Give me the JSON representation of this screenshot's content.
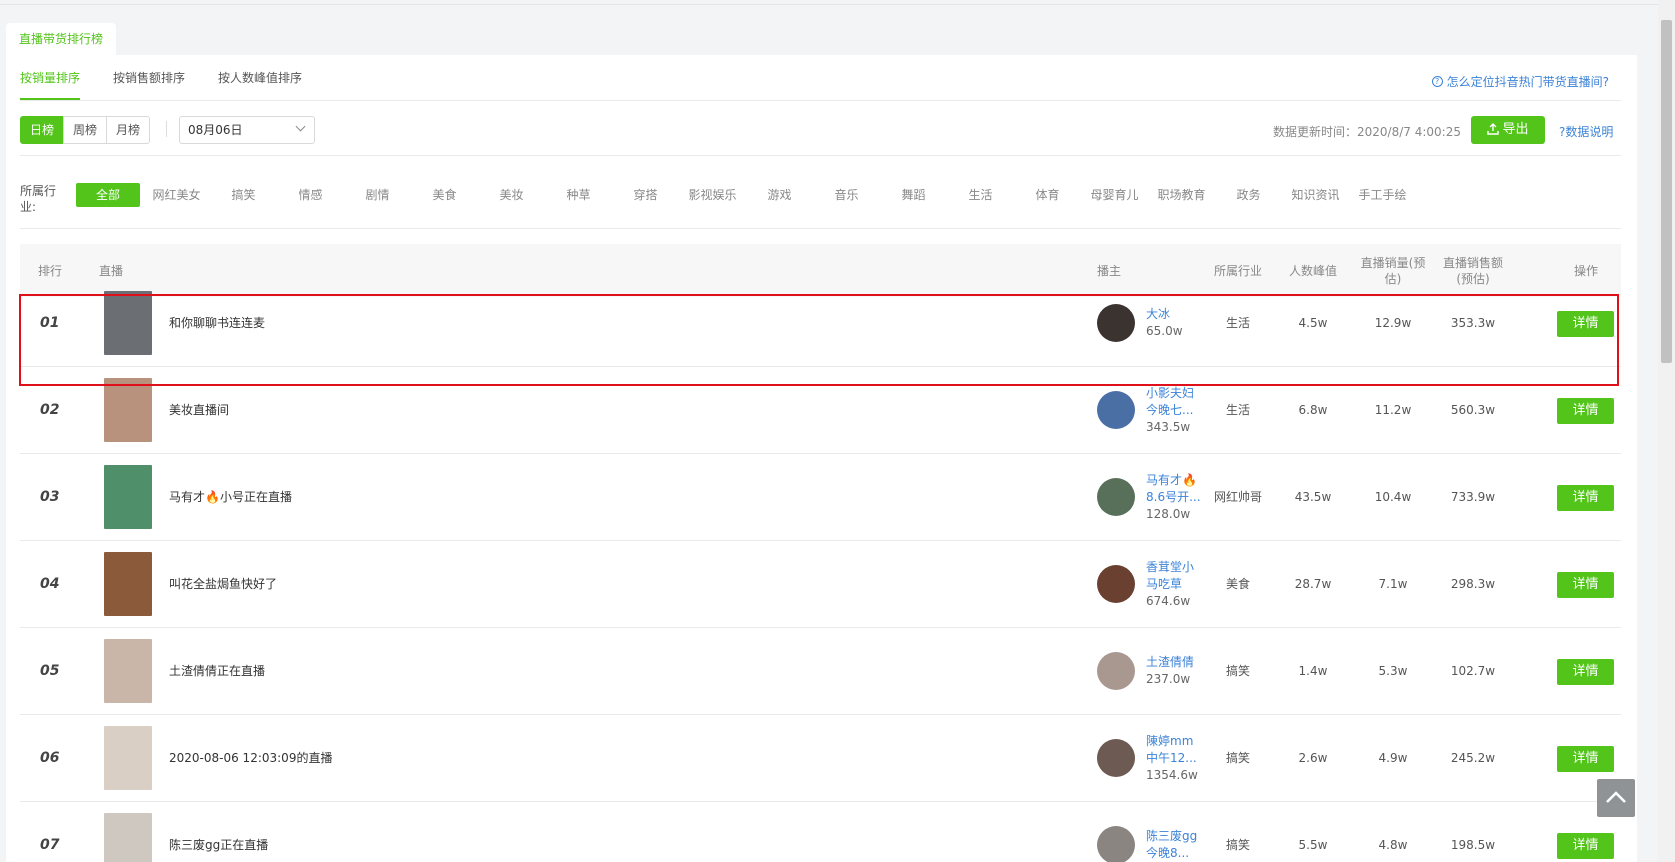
{
  "page_tab": "直播带货排行榜",
  "sort_tabs": [
    {
      "label": "按销量排序",
      "active": true
    },
    {
      "label": "按销售额排序",
      "active": false
    },
    {
      "label": "按人数峰值排序",
      "active": false
    }
  ],
  "help_link": "怎么定位抖音热门带货直播间?",
  "period_buttons": [
    {
      "label": "日榜",
      "active": true
    },
    {
      "label": "周榜",
      "active": false
    },
    {
      "label": "月榜",
      "active": false
    }
  ],
  "date_select": {
    "value": "08月06日"
  },
  "update_time": "数据更新时间：2020/8/7 4:00:25",
  "export_label": "导出",
  "data_explain": "?数据说明",
  "industry_label": "所属行业:",
  "industries": [
    {
      "label": "全部",
      "active": true
    },
    {
      "label": "网红美女"
    },
    {
      "label": "搞笑"
    },
    {
      "label": "情感"
    },
    {
      "label": "剧情"
    },
    {
      "label": "美食"
    },
    {
      "label": "美妆"
    },
    {
      "label": "种草"
    },
    {
      "label": "穿搭"
    },
    {
      "label": "影视娱乐"
    },
    {
      "label": "游戏"
    },
    {
      "label": "音乐"
    },
    {
      "label": "舞蹈"
    },
    {
      "label": "生活"
    },
    {
      "label": "体育"
    },
    {
      "label": "母婴育儿"
    },
    {
      "label": "职场教育"
    },
    {
      "label": "政务"
    },
    {
      "label": "知识资讯"
    },
    {
      "label": "手工手绘"
    }
  ],
  "table": {
    "headers": {
      "rank": "排行",
      "live": "直播",
      "anchor": "播主",
      "industry": "所属行业",
      "peak": "人数峰值",
      "sales": "直播销量(预估)",
      "amount": "直播销售额(预估)",
      "action": "操作"
    },
    "detail_label": "详情",
    "rows": [
      {
        "rank": "01",
        "title": "和你聊聊书连连麦",
        "anchor_name": "大冰",
        "anchor_fans": "65.0w",
        "industry": "生活",
        "peak": "4.5w",
        "sales": "12.9w",
        "amount": "353.3w",
        "thumb_color": "#6b6e73",
        "avatar_color": "#3a3330"
      },
      {
        "rank": "02",
        "title": "美妆直播间",
        "anchor_name": "小影夫妇 今晚七...",
        "anchor_fans": "343.5w",
        "industry": "生活",
        "peak": "6.8w",
        "sales": "11.2w",
        "amount": "560.3w",
        "thumb_color": "#b8927c",
        "avatar_color": "#4a6fa5"
      },
      {
        "rank": "03",
        "title": "马有才🔥小号正在直播",
        "anchor_name": "马有才🔥 8.6号开...",
        "anchor_fans": "128.0w",
        "industry": "网红帅哥",
        "peak": "43.5w",
        "sales": "10.4w",
        "amount": "733.9w",
        "thumb_color": "#4f8f6a",
        "avatar_color": "#58705a"
      },
      {
        "rank": "04",
        "title": "叫花全盐焗鱼快好了",
        "anchor_name": "香茸堂小 马吃草",
        "anchor_fans": "674.6w",
        "industry": "美食",
        "peak": "28.7w",
        "sales": "7.1w",
        "amount": "298.3w",
        "thumb_color": "#8a5a3a",
        "avatar_color": "#6a4030"
      },
      {
        "rank": "05",
        "title": "土渣倩倩正在直播",
        "anchor_name": "土渣倩倩",
        "anchor_fans": "237.0w",
        "industry": "搞笑",
        "peak": "1.4w",
        "sales": "5.3w",
        "amount": "102.7w",
        "thumb_color": "#c9b6a8",
        "avatar_color": "#a89890"
      },
      {
        "rank": "06",
        "title": "2020-08-06 12:03:09的直播",
        "anchor_name": "陳婷mm 中午12...",
        "anchor_fans": "1354.6w",
        "industry": "搞笑",
        "peak": "2.6w",
        "sales": "4.9w",
        "amount": "245.2w",
        "thumb_color": "#d9cfc5",
        "avatar_color": "#6d5a52"
      },
      {
        "rank": "07",
        "title": "陈三废gg正在直播",
        "anchor_name": "陈三废gg 今晚8...",
        "anchor_fans": "",
        "industry": "搞笑",
        "peak": "5.5w",
        "sales": "4.8w",
        "amount": "198.5w",
        "thumb_color": "#cfc8c0",
        "avatar_color": "#8a8580"
      }
    ]
  },
  "icons": {
    "help": "question-circle-icon",
    "export": "upload-icon",
    "back_top": "chevron-up-icon"
  },
  "colors": {
    "accent": "#52c41a",
    "link": "#3b83d8",
    "highlight": "#e0101a"
  }
}
